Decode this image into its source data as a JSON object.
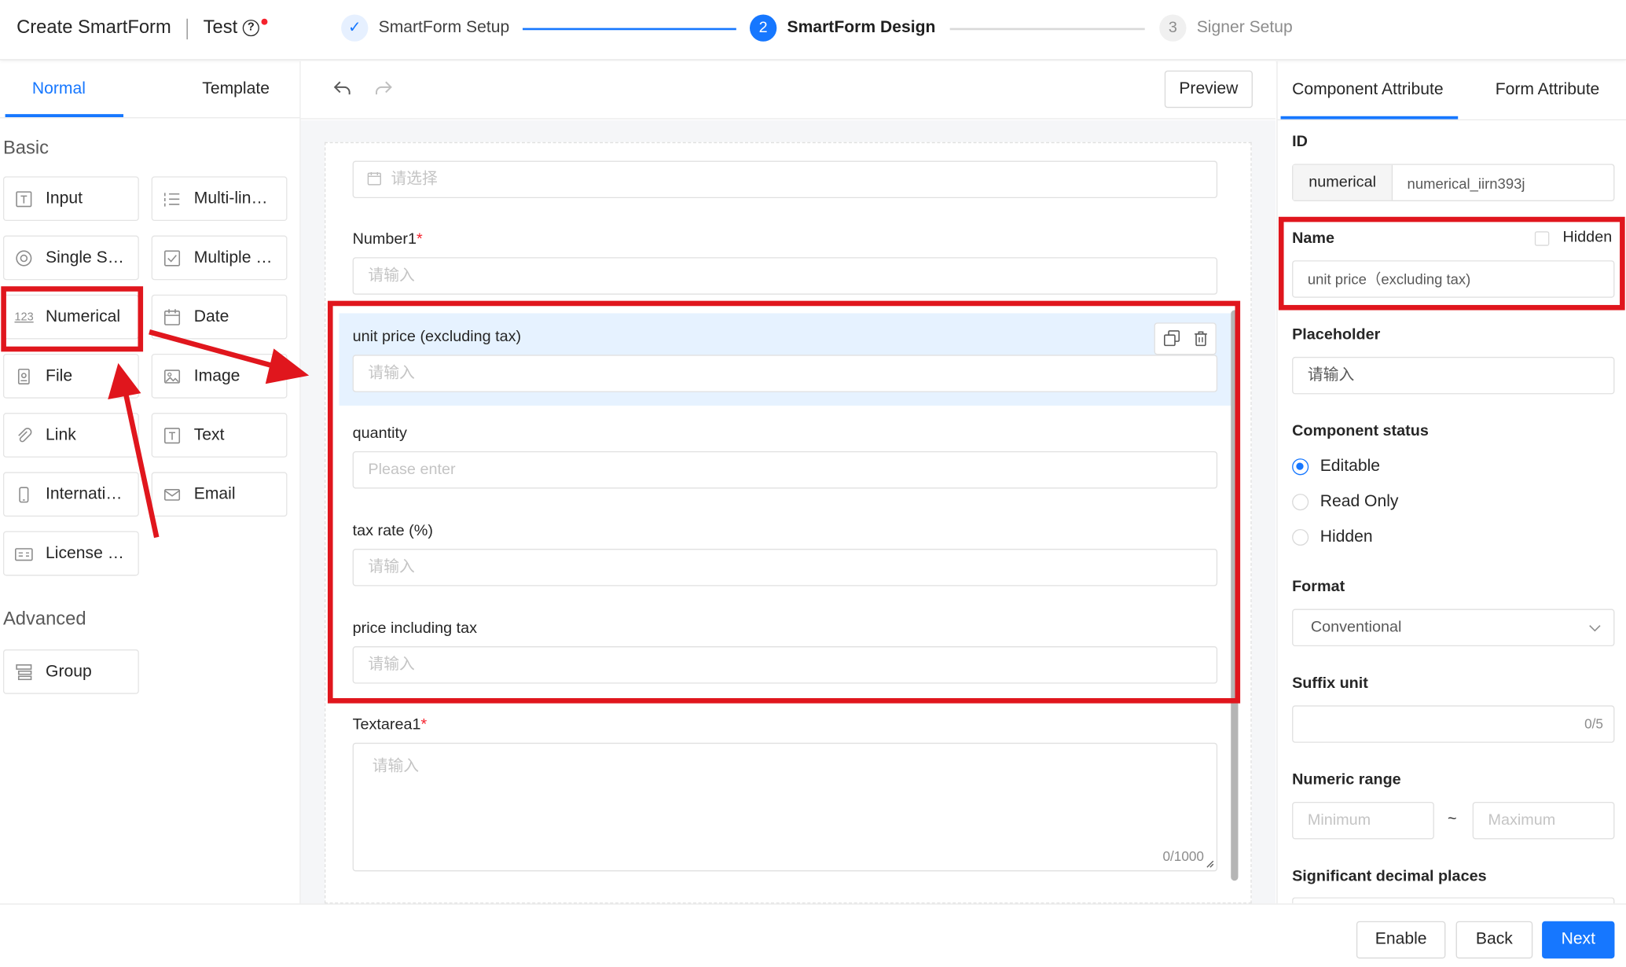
{
  "header": {
    "app_title": "Create SmartForm",
    "project_name": "Test",
    "steps": [
      {
        "index": "✓",
        "label": "SmartForm Setup",
        "state": "done"
      },
      {
        "index": "2",
        "label": "SmartForm Design",
        "state": "active"
      },
      {
        "index": "3",
        "label": "Signer Setup",
        "state": "pending"
      }
    ]
  },
  "left": {
    "tabs": [
      "Normal",
      "Template"
    ],
    "basic_title": "Basic",
    "advanced_title": "Advanced",
    "basic_components": [
      {
        "label": "Input",
        "icon": "text-box-icon"
      },
      {
        "label": "Multi-lin…",
        "icon": "multiline-icon"
      },
      {
        "label": "Single S…",
        "icon": "radio-icon"
      },
      {
        "label": "Multiple …",
        "icon": "checkbox-icon"
      },
      {
        "label": "Numerical",
        "icon": "number-123-icon"
      },
      {
        "label": "Date",
        "icon": "calendar-icon"
      },
      {
        "label": "File",
        "icon": "file-icon"
      },
      {
        "label": "Image",
        "icon": "image-icon"
      },
      {
        "label": "Link",
        "icon": "paperclip-icon"
      },
      {
        "label": "Text",
        "icon": "text-icon"
      },
      {
        "label": "Internati…",
        "icon": "phone-icon"
      },
      {
        "label": "Email",
        "icon": "mail-icon"
      },
      {
        "label": "License …",
        "icon": "id-card-icon"
      }
    ],
    "advanced_components": [
      {
        "label": "Group",
        "icon": "group-icon"
      }
    ]
  },
  "toolbar": {
    "preview_label": "Preview"
  },
  "canvas": {
    "date_placeholder": "请选择",
    "fields": [
      {
        "label": "Number1",
        "required": "*",
        "placeholder": "请输入"
      },
      {
        "label": "unit price (excluding tax)",
        "required": "",
        "placeholder": "请输入"
      },
      {
        "label": "quantity",
        "required": "",
        "placeholder": "Please enter"
      },
      {
        "label": "tax rate (%)",
        "required": "",
        "placeholder": "请输入"
      },
      {
        "label": "price including tax",
        "required": "",
        "placeholder": "请输入"
      }
    ],
    "textarea": {
      "label": "Textarea1",
      "required": "*",
      "placeholder": "请输入",
      "count": "0/1000"
    }
  },
  "right": {
    "tabs": [
      "Component Attribute",
      "Form Attribute"
    ],
    "id_label": "ID",
    "id_prefix": "numerical",
    "id_value": "numerical_iirn393j",
    "name_label": "Name",
    "hidden_label": "Hidden",
    "name_value": "unit price（excluding tax)",
    "placeholder_label": "Placeholder",
    "placeholder_value": "请输入",
    "status_label": "Component status",
    "status_options": [
      "Editable",
      "Read Only",
      "Hidden"
    ],
    "format_label": "Format",
    "format_value": "Conventional",
    "suffix_label": "Suffix unit",
    "suffix_count": "0/5",
    "range_label": "Numeric range",
    "range_min_placeholder": "Minimum",
    "range_sep": "~",
    "range_max_placeholder": "Maximum",
    "decimal_label": "Significant decimal places"
  },
  "footer": {
    "enable_label": "Enable",
    "back_label": "Back",
    "next_label": "Next"
  },
  "colors": {
    "accent": "#1677ff",
    "annotation_red": "#e0161d"
  }
}
